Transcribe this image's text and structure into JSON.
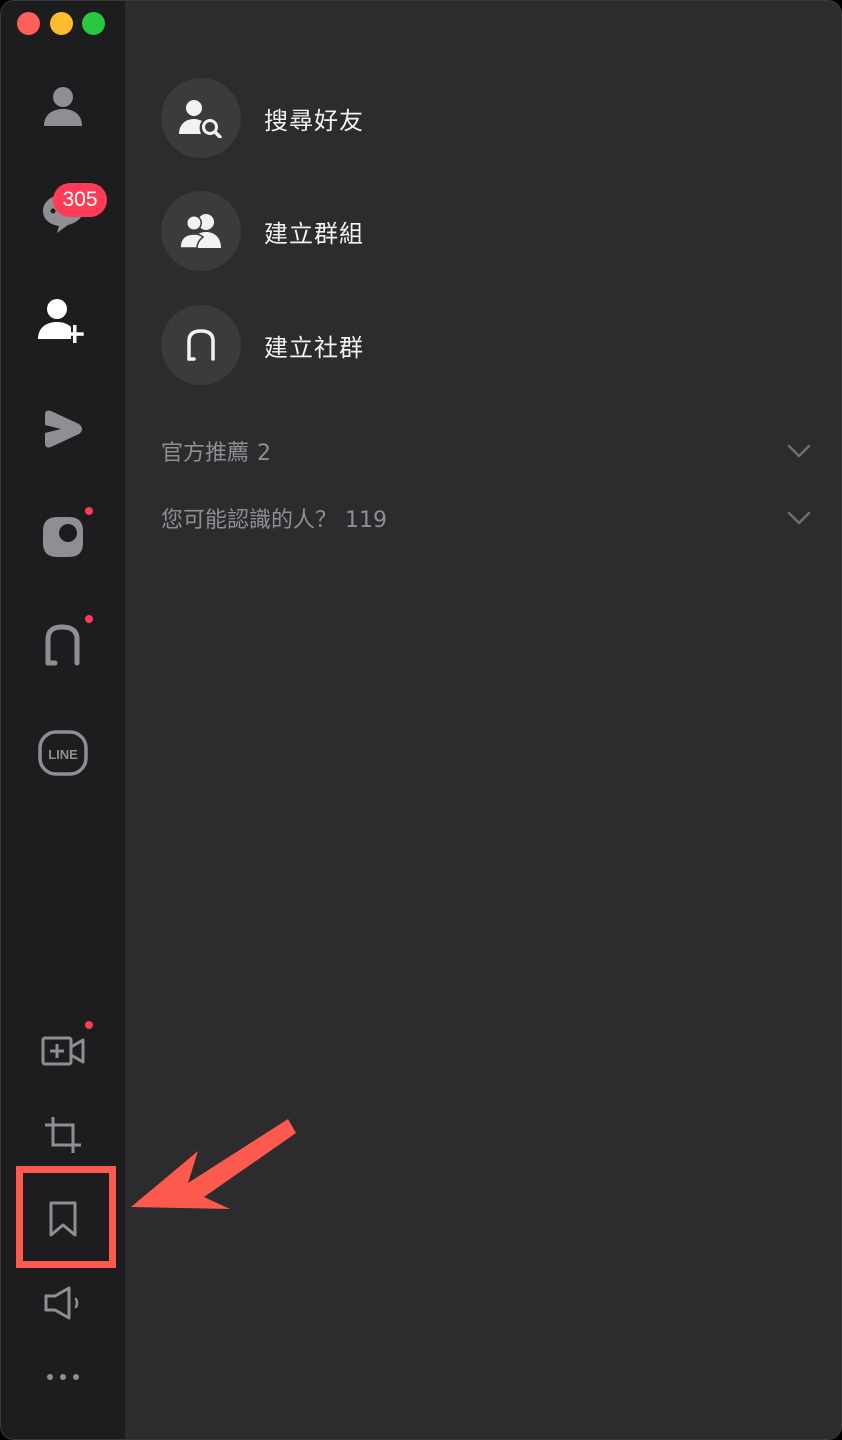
{
  "window": {
    "controls": [
      "close",
      "minimize",
      "maximize"
    ]
  },
  "sidebar": {
    "items": [
      {
        "id": "friends",
        "icon": "person-icon"
      },
      {
        "id": "chats",
        "icon": "chat-bubble-icon",
        "badge": "305"
      },
      {
        "id": "add-friends",
        "icon": "person-add-icon",
        "active": true
      },
      {
        "id": "voom",
        "icon": "voom-play-icon"
      },
      {
        "id": "moments",
        "icon": "moment-icon",
        "dot": true
      },
      {
        "id": "openchat",
        "icon": "openchat-icon",
        "dot": true
      },
      {
        "id": "line-official",
        "icon": "line-logo-icon",
        "logo_text": "LINE"
      }
    ],
    "bottom_items": [
      {
        "id": "video-call",
        "icon": "video-add-icon",
        "dot": true
      },
      {
        "id": "screenshot",
        "icon": "crop-icon"
      },
      {
        "id": "keep",
        "icon": "bookmark-icon",
        "highlighted": true
      },
      {
        "id": "announcements",
        "icon": "speaker-icon"
      },
      {
        "id": "more",
        "icon": "more-dots-icon"
      }
    ]
  },
  "main": {
    "actions": [
      {
        "label": "搜尋好友",
        "icon": "search-friend-icon"
      },
      {
        "label": "建立群組",
        "icon": "group-icon"
      },
      {
        "label": "建立社群",
        "icon": "community-icon"
      }
    ],
    "sections": [
      {
        "label": "官方推薦",
        "count": "2"
      },
      {
        "label": "您可能認識的人？",
        "count": "119"
      }
    ]
  },
  "colors": {
    "sidebar_bg": "#1d1d1f",
    "main_bg": "#2c2c2e",
    "badge": "#ff3b56",
    "annotation": "#fb5a4c"
  }
}
